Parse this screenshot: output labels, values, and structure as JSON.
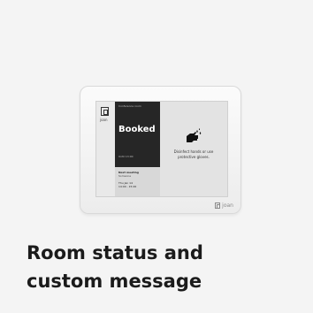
{
  "device": {
    "logo_text": "joan",
    "status": {
      "room_name": "Conference room",
      "state": "Booked",
      "until": "Until 13:00"
    },
    "next_meeting": {
      "title": "Next meeting",
      "organizer": "Someone",
      "date": "Thu Jan 14",
      "time": "14:00 - 15:00"
    },
    "message": {
      "icon": "hand-sanitize-icon",
      "text": "Disinfect hands or use protective gloves."
    },
    "brand": "joan"
  },
  "caption": {
    "line1": "Room status and",
    "line2": "custom message"
  }
}
